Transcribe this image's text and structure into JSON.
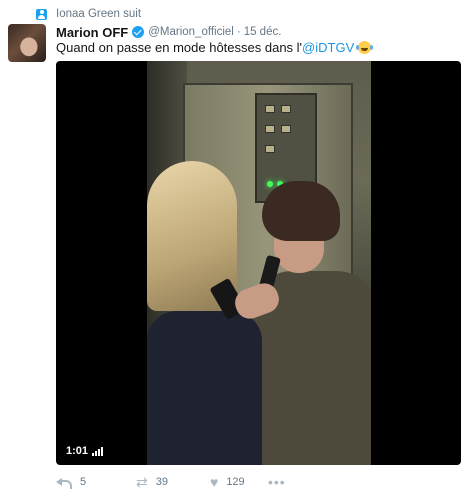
{
  "context": {
    "text": "Ionaa Green suit"
  },
  "tweet": {
    "display_name": "Marion OFF",
    "handle": "@Marion_officiel",
    "separator": "·",
    "timestamp": "15 déc.",
    "text_prefix": "Quand on passe en mode hôtesses dans l'",
    "mention": "@iDTGV"
  },
  "media": {
    "duration": "1:01"
  },
  "actions": {
    "reply_count": "5",
    "retweet_count": "39",
    "like_count": "129",
    "more": "•••"
  },
  "icons": {
    "context": "person-icon",
    "verified": "verified-badge-icon",
    "emoji": "tears-of-joy-emoji-icon",
    "volume": "volume-bars-icon",
    "reply": "reply-icon",
    "retweet": "retweet-icon",
    "like": "heart-icon",
    "more": "more-dots-icon"
  },
  "colors": {
    "link": "#1b95e0",
    "verified": "#1da1f2",
    "muted": "#657786",
    "icon": "#aab8c2"
  }
}
